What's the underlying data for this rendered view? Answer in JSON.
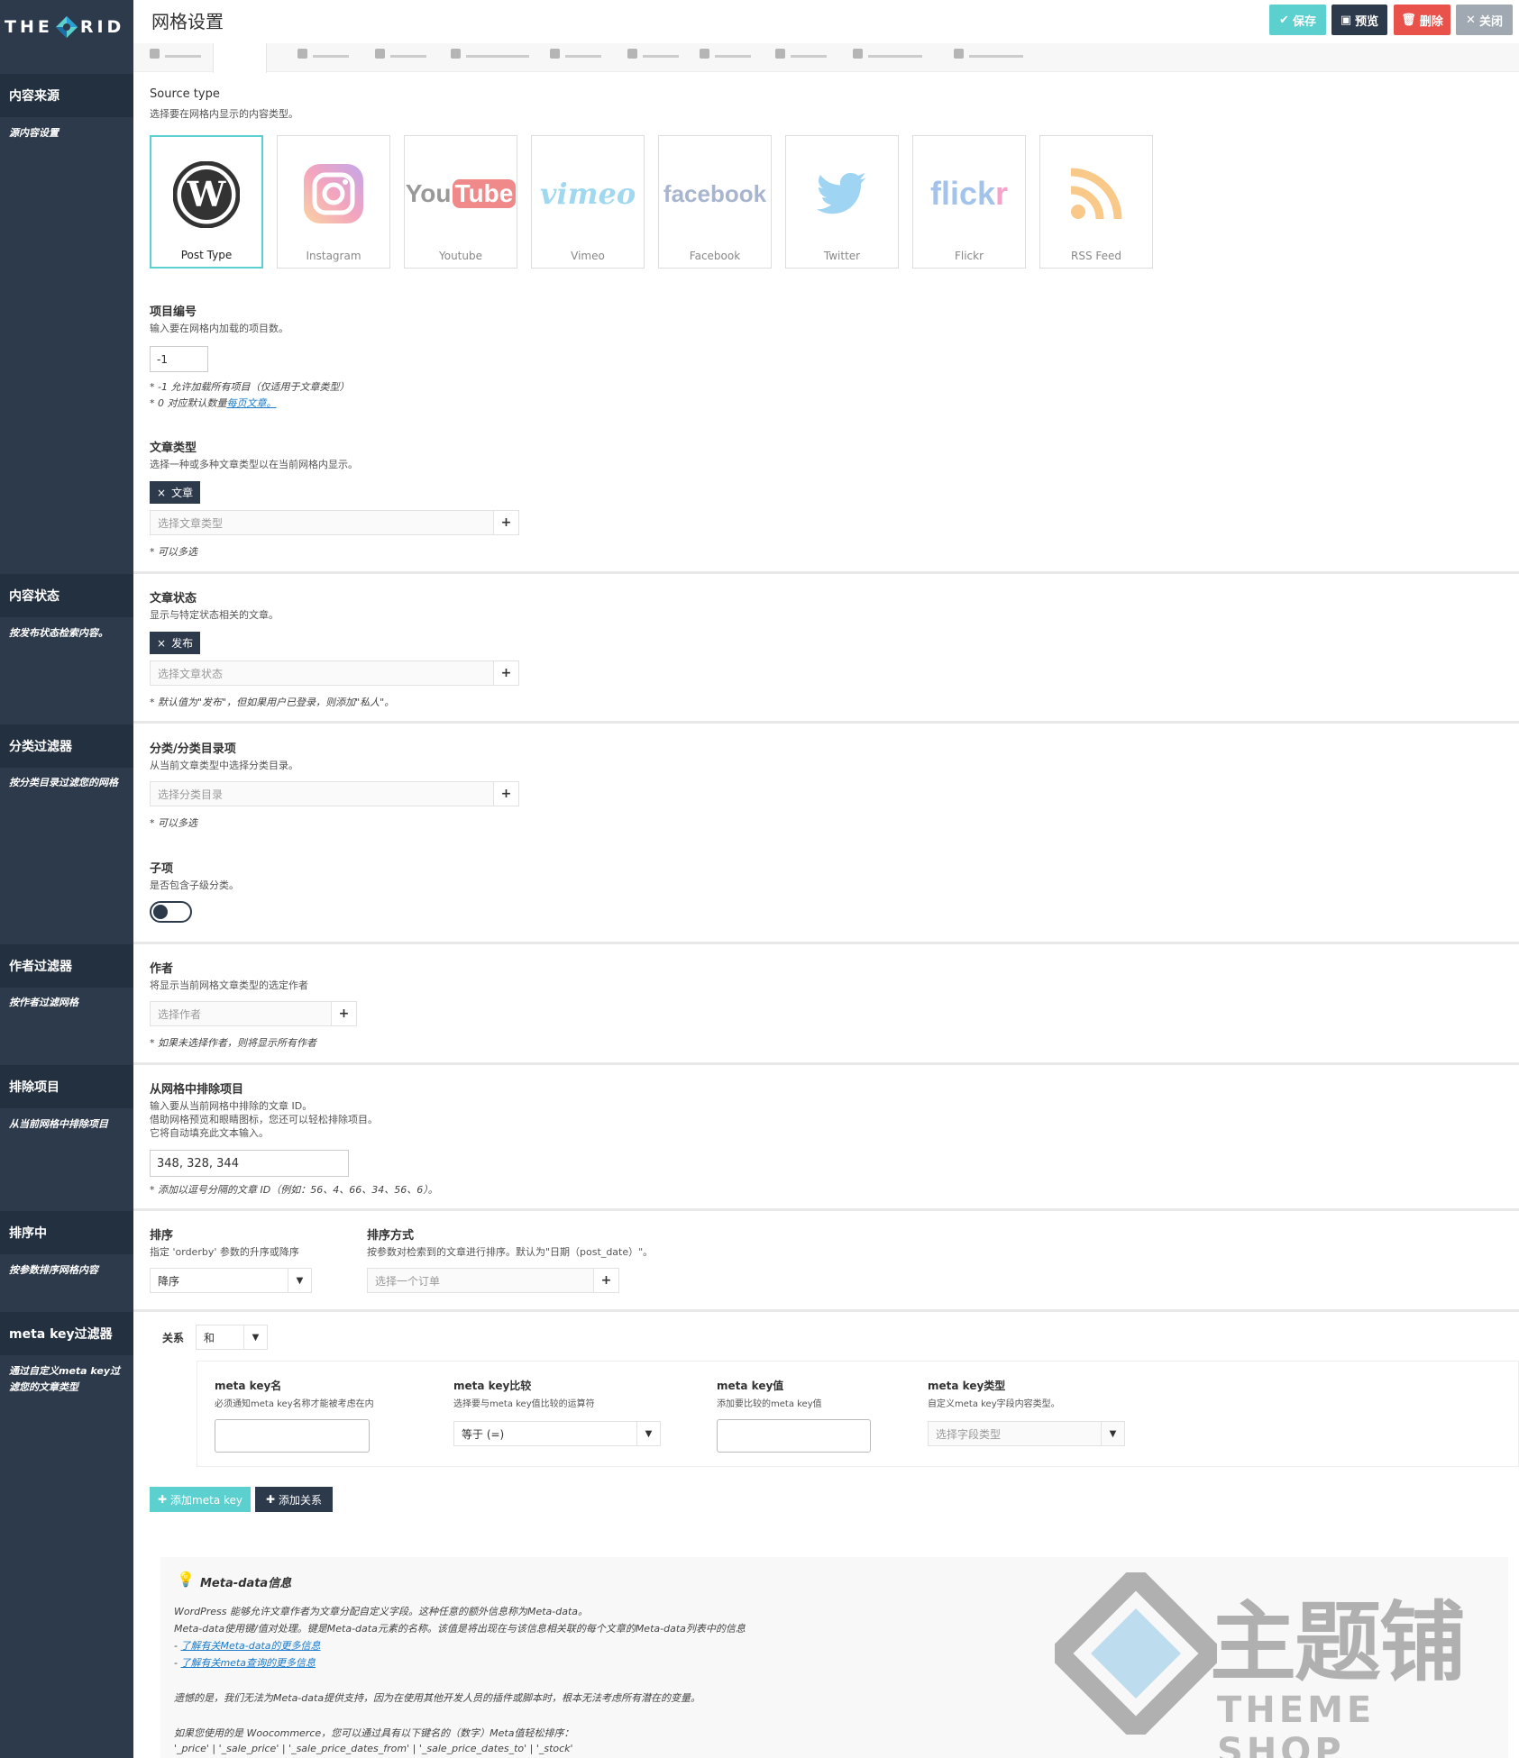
{
  "app": {
    "logo_text_left": "THE",
    "logo_text_right": "RID",
    "page_title": "网格设置",
    "buttons": {
      "save": "保存",
      "preview": "预览",
      "delete": "删除",
      "close": "关闭"
    }
  },
  "colors": {
    "accent": "#5ccfcf",
    "dark": "#2d3a4b",
    "danger": "#e9514b",
    "muted": "#a0a9b1",
    "link": "#1a7ac9"
  },
  "sidebar": {
    "sections": [
      {
        "title": "内容来源",
        "subtitle": "源内容设置"
      },
      {
        "title": "内容状态",
        "subtitle": "按发布状态检索内容。"
      },
      {
        "title": "分类过滤器",
        "subtitle": "按分类目录过滤您的网格"
      },
      {
        "title": "作者过滤器",
        "subtitle": "按作者过滤网格"
      },
      {
        "title": "排除项目",
        "subtitle": "从当前网格中排除项目"
      },
      {
        "title": "排序中",
        "subtitle": "按参数排序网格内容"
      },
      {
        "title": "meta key过滤器",
        "subtitle": "通过自定义meta key过滤您的文章类型"
      }
    ]
  },
  "source": {
    "label": "Source type",
    "desc": "选择要在网格内显示的内容类型。",
    "cards": [
      {
        "label": "Post Type",
        "icon": "wordpress-icon"
      },
      {
        "label": "Instagram",
        "icon": "instagram-icon"
      },
      {
        "label": "Youtube",
        "icon": "youtube-icon"
      },
      {
        "label": "Vimeo",
        "icon": "vimeo-icon"
      },
      {
        "label": "Facebook",
        "icon": "facebook-icon"
      },
      {
        "label": "Twitter",
        "icon": "twitter-icon"
      },
      {
        "label": "Flickr",
        "icon": "flickr-icon"
      },
      {
        "label": "RSS Feed",
        "icon": "rss-icon"
      }
    ],
    "logo_texts": {
      "youtube_you": "You",
      "youtube_tube": "Tube",
      "vimeo": "vimeo",
      "facebook": "facebook",
      "flickr_fl": "flick",
      "flickr_r": "r"
    }
  },
  "item_number": {
    "label": "项目编号",
    "desc": "输入要在网格内加载的项目数。",
    "value": "-1",
    "note1": "* -1 允许加载所有项目（仅适用于文章类型）",
    "note2_prefix": "* 0 对应默认数量",
    "note2_link": "每页文章。"
  },
  "post_type": {
    "label": "文章类型",
    "desc": "选择一种或多种文章类型以在当前网格内显示。",
    "tag": "文章",
    "placeholder": "选择文章类型",
    "note": "* 可以多选"
  },
  "post_status": {
    "label": "文章状态",
    "desc": "显示与特定状态相关的文章。",
    "tag": "发布",
    "placeholder": "选择文章状态",
    "note": "* 默认值为\"发布\"，但如果用户已登录，则添加\"私人\"。"
  },
  "category": {
    "label": "分类/分类目录项",
    "desc": "从当前文章类型中选择分类目录。",
    "placeholder": "选择分类目录",
    "note": "* 可以多选",
    "children_label": "子项",
    "children_desc": "是否包含子级分类。"
  },
  "author": {
    "label": "作者",
    "desc": "将显示当前网格文章类型的选定作者",
    "placeholder": "选择作者",
    "note": "* 如果未选择作者，则将显示所有作者"
  },
  "exclude": {
    "label": "从网格中排除项目",
    "desc1": "输入要从当前网格中排除的文章 ID。",
    "desc2": "借助网格预览和眼睛图标，您还可以轻松排除项目。",
    "desc3": "它将自动填充此文本输入。",
    "value": "348, 328, 344",
    "note": "* 添加以逗号分隔的文章 ID（例如：56、4、66、34、56、6）。"
  },
  "ordering": {
    "order_label": "排序",
    "order_desc": "指定 'orderby' 参数的升序或降序",
    "order_value": "降序",
    "orderby_label": "排序方式",
    "orderby_desc": "按参数对检索到的文章进行排序。默认为\"日期（post_date）\"。",
    "orderby_placeholder": "选择一个订单"
  },
  "meta": {
    "relation_label": "关系",
    "relation_value": "和",
    "key_label": "meta key名",
    "key_desc": "必须通知meta key名称才能被考虑在内",
    "compare_label": "meta key比较",
    "compare_desc": "选择要与meta key值比较的运算符",
    "compare_value": "等于 (=)",
    "value_label": "meta key值",
    "value_desc": "添加要比较的meta key值",
    "type_label": "meta key类型",
    "type_desc": "自定义meta key字段内容类型。",
    "type_placeholder": "选择字段类型",
    "add_key_btn": "添加meta key",
    "add_relation_btn": "添加关系"
  },
  "info": {
    "title": "Meta-data信息",
    "line1": "WordPress 能够允许文章作者为文章分配自定义字段。这种任意的额外信息称为Meta-data。",
    "line2": "Meta-data使用键/值对处理。键是Meta-data元素的名称。该值是将出现在与该信息相关联的每个文章的Meta-data列表中的信息",
    "link1": "了解有关Meta-data的更多信息",
    "link2": "了解有关meta查询的更多信息",
    "line3": "遗憾的是，我们无法为Meta-data提供支持，因为在使用其他开发人员的插件或脚本时，根本无法考虑所有潜在的变量。",
    "line4": "如果您使用的是 Woocommerce，您可以通过具有以下键名的（数字）Meta值轻松排序：",
    "line5": "'_price' | '_sale_price' | '_sale_price_dates_from' | '_sale_price_dates_to' | '_stock'"
  },
  "watermark": {
    "cn": "主题铺",
    "en": "THEME SHOP"
  }
}
